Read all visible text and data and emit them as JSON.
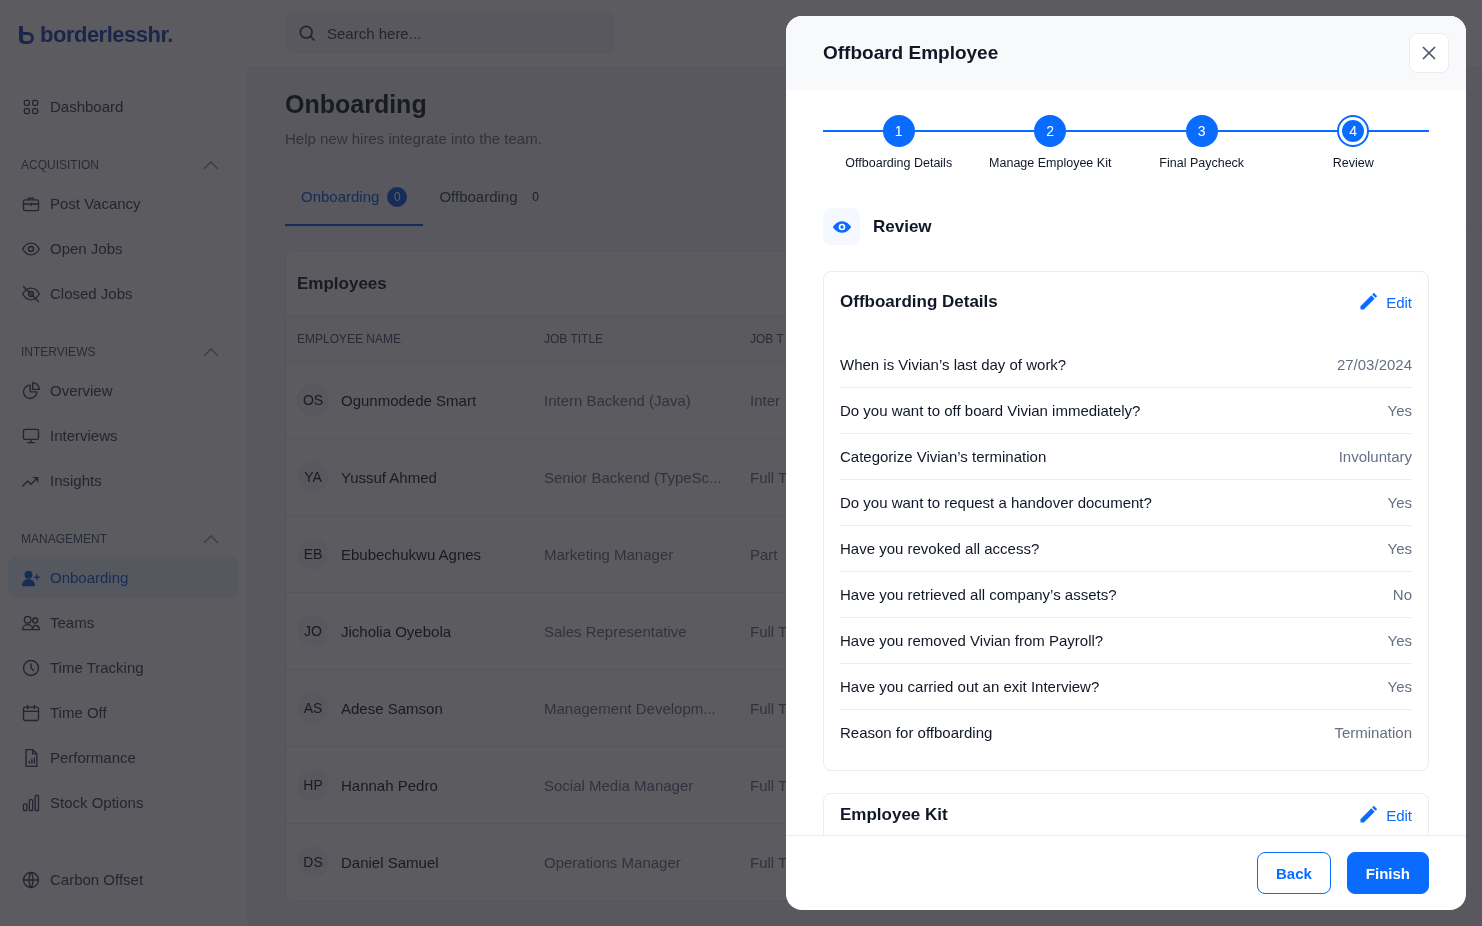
{
  "sidebar": {
    "logo": "borderlesshr.",
    "groups": [
      {
        "items": [
          {
            "label": "Dashboard",
            "selected": false
          }
        ]
      },
      {
        "heading": "ACQUISITION",
        "expanded": true,
        "items": [
          {
            "label": "Post Vacancy",
            "selected": false
          },
          {
            "label": "Open Jobs",
            "selected": false
          },
          {
            "label": "Closed Jobs",
            "selected": false
          }
        ]
      },
      {
        "heading": "INTERVIEWS",
        "expanded": true,
        "items": [
          {
            "label": "Overview",
            "selected": false
          },
          {
            "label": "Interviews",
            "selected": false
          },
          {
            "label": "Insights",
            "selected": false
          }
        ]
      },
      {
        "heading": "MANAGEMENT",
        "expanded": true,
        "items": [
          {
            "label": "Onboarding",
            "selected": true
          },
          {
            "label": "Teams",
            "selected": false
          },
          {
            "label": "Time Tracking",
            "selected": false
          },
          {
            "label": "Time Off",
            "selected": false
          },
          {
            "label": "Performance",
            "selected": false
          },
          {
            "label": "Stock Options",
            "selected": false
          }
        ]
      },
      {
        "items": [
          {
            "label": "Carbon Offset",
            "selected": false
          }
        ]
      }
    ]
  },
  "search": {
    "placeholder": "Search here..."
  },
  "page": {
    "title": "Onboarding",
    "subtitle": "Help new hires integrate into the team."
  },
  "tabs": [
    {
      "label": "Onboarding",
      "count": "0",
      "selected": true
    },
    {
      "label": "Offboarding",
      "count": "0",
      "selected": false
    }
  ],
  "table": {
    "title": "Employees",
    "columns": [
      "EMPLOYEE NAME",
      "JOB TITLE",
      "JOB T"
    ],
    "rows": [
      {
        "initials": "OS",
        "name": "Ogunmodede Smart",
        "job_title": "Intern Backend (Java)",
        "column_3": "Inter"
      },
      {
        "initials": "YA",
        "name": "Yussuf Ahmed",
        "job_title": "Senior Backend (TypeSc...",
        "column_3": "Full T"
      },
      {
        "initials": "EB",
        "name": "Ebubechukwu Agnes",
        "job_title": "Marketing Manager",
        "column_3": "Part"
      },
      {
        "initials": "JO",
        "name": "Jicholia Oyebola",
        "job_title": "Sales Representative",
        "column_3": "Full T"
      },
      {
        "initials": "AS",
        "name": "Adese Samson",
        "job_title": "Management Developm...",
        "column_3": "Full T"
      },
      {
        "initials": "HP",
        "name": "Hannah Pedro",
        "job_title": "Social Media Manager",
        "column_3": "Full T"
      },
      {
        "initials": "DS",
        "name": "Daniel Samuel",
        "job_title": "Operations Manager",
        "column_3": "Full T"
      }
    ]
  },
  "modal": {
    "title": "Offboard Employee",
    "steps": [
      {
        "number": "1",
        "label": "Offboarding Details",
        "selected": false
      },
      {
        "number": "2",
        "label": "Manage Employee Kit",
        "selected": false
      },
      {
        "number": "3",
        "label": "Final Paycheck",
        "selected": false
      },
      {
        "number": "4",
        "label": "Review",
        "selected": true
      }
    ],
    "section_title": "Review",
    "cards": [
      {
        "title": "Offboarding Details",
        "edit": "Edit",
        "rows": [
          {
            "question": "When is Vivian’s last day of work?",
            "answer": "27/03/2024"
          },
          {
            "question": "Do you want to off board Vivian immediately?",
            "answer": "Yes"
          },
          {
            "question": "Categorize Vivian’s termination",
            "answer": "Involuntary"
          },
          {
            "question": "Do you want to request a handover document?",
            "answer": "Yes"
          },
          {
            "question": "Have you revoked all access?",
            "answer": "Yes"
          },
          {
            "question": "Have you retrieved all company’s assets?",
            "answer": "No"
          },
          {
            "question": "Have you removed Vivian from Payroll?",
            "answer": "Yes"
          },
          {
            "question": "Have you carried out an exit Interview?",
            "answer": "Yes"
          },
          {
            "question": "Reason for offboarding",
            "answer": "Termination"
          }
        ]
      },
      {
        "title": "Employee Kit",
        "edit": "Edit"
      }
    ],
    "buttons": {
      "back": "Back",
      "finish": "Finish"
    }
  }
}
